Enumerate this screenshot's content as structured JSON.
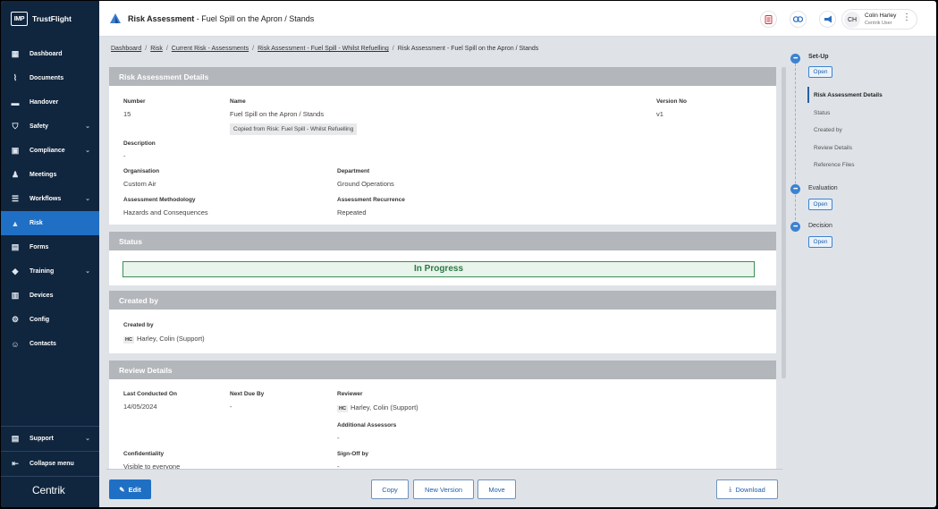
{
  "app": {
    "logo_text": "IMP",
    "brand": "TrustFlight",
    "footer_brand": "Centrik"
  },
  "sidebar": {
    "items": [
      {
        "label": "Dashboard",
        "icon": "dashboard-icon",
        "chevron": false,
        "active": false
      },
      {
        "label": "Documents",
        "icon": "paperclip-icon",
        "chevron": false,
        "active": false
      },
      {
        "label": "Handover",
        "icon": "handover-icon",
        "chevron": false,
        "active": false
      },
      {
        "label": "Safety",
        "icon": "shield-icon",
        "chevron": true,
        "active": false
      },
      {
        "label": "Compliance",
        "icon": "compliance-icon",
        "chevron": true,
        "active": false
      },
      {
        "label": "Meetings",
        "icon": "meetings-icon",
        "chevron": false,
        "active": false
      },
      {
        "label": "Workflows",
        "icon": "workflows-icon",
        "chevron": true,
        "active": false
      },
      {
        "label": "Risk",
        "icon": "risk-icon",
        "chevron": false,
        "active": true
      },
      {
        "label": "Forms",
        "icon": "forms-icon",
        "chevron": false,
        "active": false
      },
      {
        "label": "Training",
        "icon": "graduation-cap-icon",
        "chevron": true,
        "active": false
      },
      {
        "label": "Devices",
        "icon": "devices-icon",
        "chevron": false,
        "active": false
      },
      {
        "label": "Config",
        "icon": "config-icon",
        "chevron": false,
        "active": false
      },
      {
        "label": "Contacts",
        "icon": "contacts-icon",
        "chevron": false,
        "active": false
      }
    ],
    "support_label": "Support",
    "collapse_label": "Collapse menu"
  },
  "header": {
    "module": "Risk Assessment",
    "separator": " - ",
    "record": "Fuel Spill on the Apron / Stands",
    "user_initials": "CH",
    "user_name": "Colin Harley",
    "user_role": "Centrik User"
  },
  "breadcrumb": {
    "items": [
      "Dashboard",
      "Risk",
      "Current Risk - Assessments",
      "Risk Assessment - Fuel Spill - Whilst Refuelling"
    ],
    "current": "Risk Assessment - Fuel Spill on the Apron / Stands"
  },
  "details": {
    "heading": "Risk Assessment Details",
    "number_label": "Number",
    "number": "15",
    "name_label": "Name",
    "name": "Fuel Spill on the Apron / Stands",
    "copied_from": "Copied from Risk: Fuel Spill - Whilst Refuelling",
    "version_label": "Version No",
    "version": "v1",
    "description_label": "Description",
    "description": "-",
    "organisation_label": "Organisation",
    "organisation": "Custom Air",
    "department_label": "Department",
    "department": "Ground Operations",
    "methodology_label": "Assessment Methodology",
    "methodology": "Hazards and Consequences",
    "recurrence_label": "Assessment Recurrence",
    "recurrence": "Repeated"
  },
  "status": {
    "heading": "Status",
    "value": "In Progress"
  },
  "created": {
    "heading": "Created by",
    "label": "Created by",
    "initials": "HC",
    "name": "Harley, Colin (Support)"
  },
  "review": {
    "heading": "Review Details",
    "last_label": "Last Conducted On",
    "last": "14/05/2024",
    "next_label": "Next Due By",
    "next": "-",
    "reviewer_label": "Reviewer",
    "reviewer_initials": "HC",
    "reviewer": "Harley, Colin (Support)",
    "assessors_label": "Additional Assessors",
    "assessors": "-",
    "confidentiality_label": "Confidentiality",
    "confidentiality": "Visible to everyone",
    "signoff_label": "Sign-Off by",
    "signoff": "-"
  },
  "footer": {
    "edit": "Edit",
    "copy": "Copy",
    "new_version": "New Version",
    "move": "Move",
    "download": "Download"
  },
  "stepper": {
    "setup": {
      "title": "Set-Up",
      "badge": "Open",
      "subs": [
        "Risk Assessment Details",
        "Status",
        "Created by",
        "Review Details",
        "Reference Files"
      ]
    },
    "evaluation": {
      "title": "Evaluation",
      "badge": "Open"
    },
    "decision": {
      "title": "Decision",
      "badge": "Open"
    }
  },
  "colors": {
    "sidebar": "#10253e",
    "accent": "#1f6fc4",
    "card_header": "#b3b6ba",
    "status_green": "#2a7a45"
  }
}
